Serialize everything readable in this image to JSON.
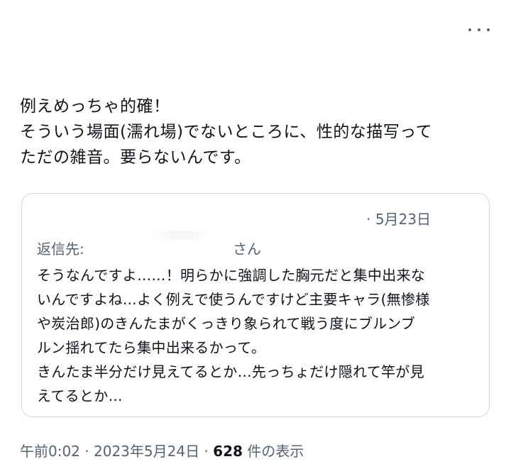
{
  "tweet": {
    "text": "例えめっちゃ的確！\nそういう場面(濡れ場)でないところに、性的な描写って\nただの雑音。要らないんです。"
  },
  "quote": {
    "date": "· 5月23日",
    "reply_to_label": "返信先:",
    "reply_to_suffix": "さん",
    "text": "そうなんですよ……！明らかに強調した胸元だと集中出来な\nいんですよね…よく例えで使うんですけど主要キャラ(無惨様\nや炭治郎)のきんたまがくっきり象られて戦う度にブルンブ\nルン揺れてたら集中出来るかって。\nきんたま半分だけ見えてるとか…先っちょだけ隠れて竿が見\nえてるとか…"
  },
  "meta": {
    "time": "午前0:02",
    "separator": " · ",
    "date": "2023年5月24日",
    "separator2": " · ",
    "view_count": "628",
    "view_label": " 件の表示"
  },
  "icons": {
    "more": "more-horizontal-icon"
  }
}
